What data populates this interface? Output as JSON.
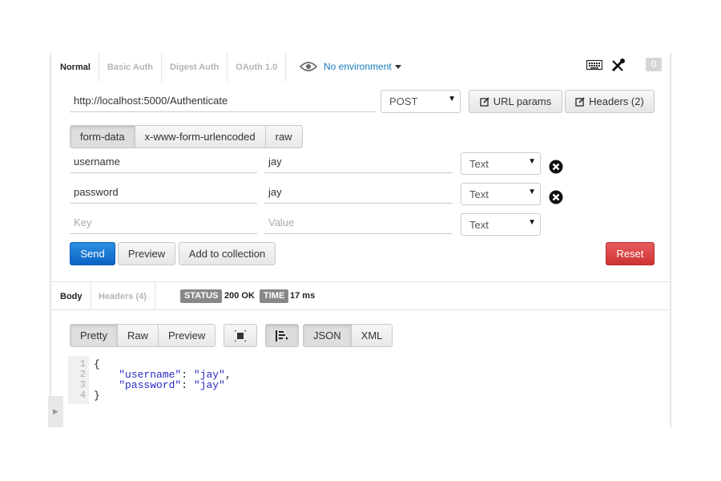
{
  "auth_tabs": [
    "Normal",
    "Basic Auth",
    "Digest Auth",
    "OAuth 1.0"
  ],
  "environment": {
    "label": "No environment"
  },
  "counter": "0",
  "request": {
    "url": "http://localhost:5000/Authenticate",
    "method": "POST",
    "url_params_label": "URL params",
    "headers_label": "Headers (2)"
  },
  "body_types": [
    "form-data",
    "x-www-form-urlencoded",
    "raw"
  ],
  "form_rows": [
    {
      "key": "username",
      "value": "jay",
      "type": "Text"
    },
    {
      "key": "password",
      "value": "jay",
      "type": "Text"
    }
  ],
  "new_row": {
    "key_placeholder": "Key",
    "value_placeholder": "Value",
    "type": "Text"
  },
  "actions": {
    "send": "Send",
    "preview": "Preview",
    "add_to_collection": "Add to collection",
    "reset": "Reset"
  },
  "response": {
    "tabs": [
      "Body",
      "Headers (4)"
    ],
    "status_label": "STATUS",
    "status_value": "200 OK",
    "time_label": "TIME",
    "time_value": "17 ms",
    "view_modes": [
      "Pretty",
      "Raw",
      "Preview"
    ],
    "formats": [
      "JSON",
      "XML"
    ],
    "line_numbers": [
      "1",
      "2",
      "3",
      "4"
    ],
    "code": {
      "open": "{",
      "line2_key": "\"username\"",
      "line2_sep": ": ",
      "line2_val": "\"jay\"",
      "line2_end": ",",
      "line3_key": "\"password\"",
      "line3_sep": ": ",
      "line3_val": "\"jay\"",
      "close": "}"
    }
  },
  "colors": {
    "accent": "#1a7bbf",
    "send": "#0b63c6",
    "reset": "#cc3333",
    "json_string": "#2a2ac7"
  }
}
